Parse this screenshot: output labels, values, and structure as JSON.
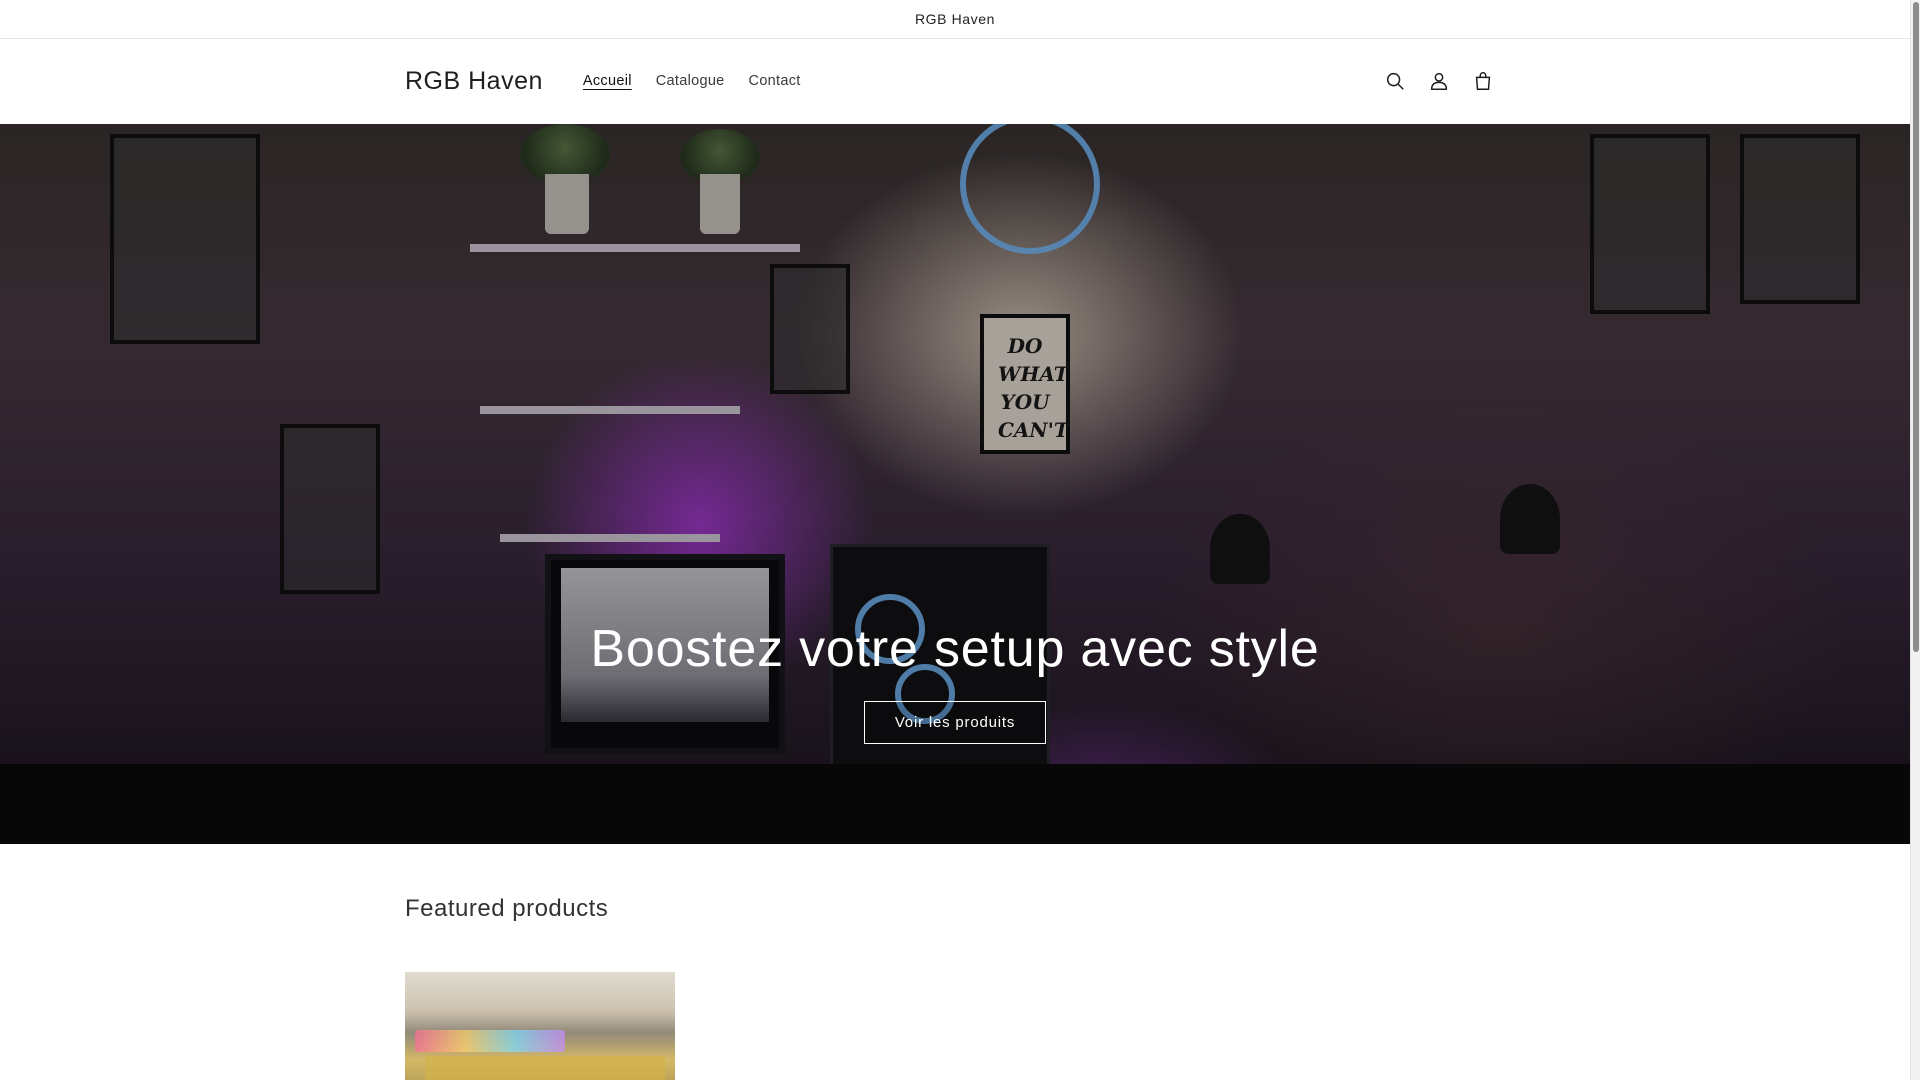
{
  "announcement": {
    "text": "RGB Haven"
  },
  "header": {
    "logo": "RGB Haven",
    "nav": [
      {
        "label": "Accueil",
        "active": true
      },
      {
        "label": "Catalogue",
        "active": false
      },
      {
        "label": "Contact",
        "active": false
      }
    ],
    "icons": [
      "search-icon",
      "account-icon",
      "cart-icon"
    ]
  },
  "hero": {
    "title": "Boostez votre setup avec style",
    "button_label": "Voir les produits",
    "poster_text": "DO WHAT YOU CAN'T"
  },
  "featured": {
    "title": "Featured products"
  },
  "colors": {
    "text": "#121212",
    "background": "#ffffff",
    "hero_accent": "#a845d8"
  }
}
